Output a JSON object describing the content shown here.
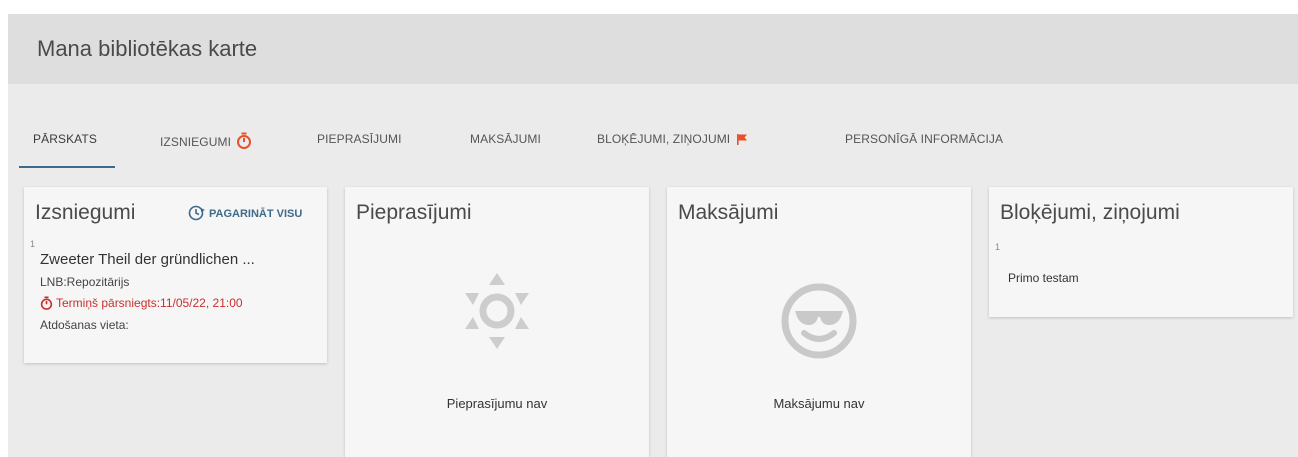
{
  "header": {
    "title": "Mana bibliotēkas karte"
  },
  "tabs": [
    {
      "label": "PĀRSKATS",
      "active": true
    },
    {
      "label": "IZSNIEGUMI",
      "icon": "timer-icon",
      "active": false
    },
    {
      "label": "PIEPRASĪJUMI",
      "active": false
    },
    {
      "label": "MAKSĀJUMI",
      "active": false
    },
    {
      "label": "BLOĶĒJUMI, ZIŅOJUMI",
      "icon": "flag-icon",
      "active": false
    },
    {
      "label": "PERSONĪGĀ INFORMĀCIJA",
      "active": false
    }
  ],
  "loans": {
    "title": "Izsniegumi",
    "renew_all_label": "PAGARINĀT VISU",
    "items": [
      {
        "number": "1",
        "title": "Zweeter Theil der gründlichen ...",
        "library": "LNB:Repozitārijs",
        "due": "Termiņš pārsniegts:11/05/22, 21:00",
        "return_location": "Atdošanas vieta:"
      }
    ]
  },
  "requests": {
    "title": "Pieprasījumi",
    "empty_text": "Pieprasījumu nav",
    "empty_icon": "sun-icon"
  },
  "fines": {
    "title": "Maksājumi",
    "empty_text": "Maksājumu nav",
    "empty_icon": "sunglasses-smiley-icon"
  },
  "blocks": {
    "title": "Bloķējumi, ziņojumi",
    "items": [
      {
        "number": "1",
        "text": "Primo testam"
      }
    ]
  },
  "colors": {
    "accent": "#3f6a8a",
    "overdue": "#c9302c",
    "icon_gray": "#c9c9c9",
    "timer_orange": "#e8502a"
  }
}
